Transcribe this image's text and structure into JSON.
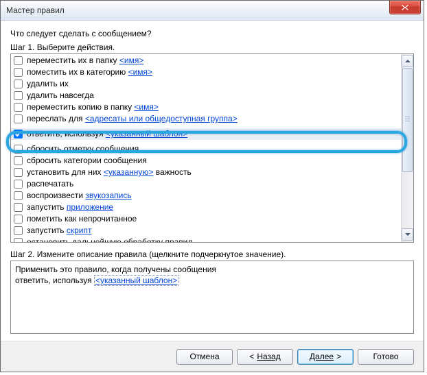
{
  "window": {
    "title": "Мастер правил"
  },
  "question": "Что следует сделать с сообщением?",
  "step1_label": "Шаг 1. Выберите действия.",
  "actions": [
    {
      "checked": false,
      "pre": "переместить их в папку ",
      "link": "<имя>",
      "post": ""
    },
    {
      "checked": false,
      "pre": "поместить их в категорию ",
      "link": "<имя>",
      "post": ""
    },
    {
      "checked": false,
      "pre": "удалить их",
      "link": "",
      "post": ""
    },
    {
      "checked": false,
      "pre": "удалить навсегда",
      "link": "",
      "post": ""
    },
    {
      "checked": false,
      "pre": "переместить копию в папку ",
      "link": "<имя>",
      "post": ""
    },
    {
      "checked": false,
      "pre": "переслать для ",
      "link": "<адресаты или общедоступная группа>",
      "post": ""
    },
    {
      "checked": false,
      "pre": "",
      "link": "",
      "post": "",
      "obscured": true
    },
    {
      "checked": true,
      "pre": "ответить, используя ",
      "link": "<указанный шаблон>",
      "post": "",
      "selected": true
    },
    {
      "checked": false,
      "pre": "",
      "link": "",
      "post": "",
      "obscured": true
    },
    {
      "checked": false,
      "pre": "сбросить отметку сообщения",
      "link": "",
      "post": ""
    },
    {
      "checked": false,
      "pre": "сбросить категории сообщения",
      "link": "",
      "post": ""
    },
    {
      "checked": false,
      "pre": "установить для них ",
      "link": "<указанную>",
      "post": " важность"
    },
    {
      "checked": false,
      "pre": "распечатать",
      "link": "",
      "post": ""
    },
    {
      "checked": false,
      "pre": "воспроизвести ",
      "link": "звукозапись",
      "post": ""
    },
    {
      "checked": false,
      "pre": "запустить ",
      "link": "приложение",
      "post": ""
    },
    {
      "checked": false,
      "pre": "пометить как непрочитанное",
      "link": "",
      "post": ""
    },
    {
      "checked": false,
      "pre": "запустить ",
      "link": "скрипт",
      "post": ""
    },
    {
      "checked": false,
      "pre": "остановить дальнейшую обработку правил",
      "link": "",
      "post": ""
    }
  ],
  "step2_label": "Шаг 2. Измените описание правила (щелкните подчеркнутое значение).",
  "description": {
    "line1": "Применить это правило, когда получены сообщения",
    "line2_pre": "ответить, используя ",
    "line2_link": "<указанный шаблон>"
  },
  "buttons": {
    "cancel": "Отмена",
    "back_prefix": "< ",
    "back": "Назад",
    "next": "Далее",
    "next_suffix": " >",
    "finish": "Готово"
  }
}
